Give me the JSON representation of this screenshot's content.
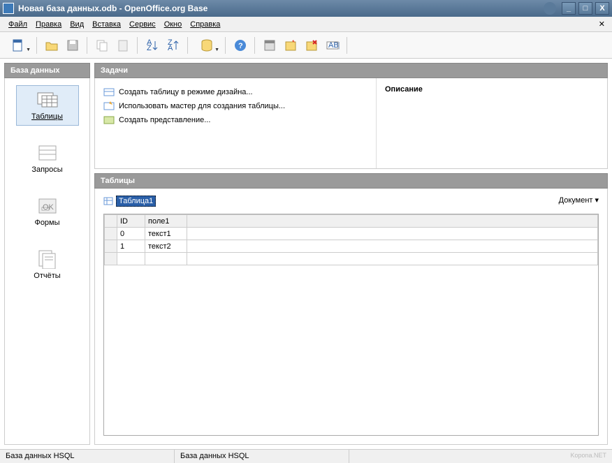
{
  "title": "Новая база данных.odb - OpenOffice.org Base",
  "window_controls": {
    "min": "_",
    "max": "□",
    "close": "X"
  },
  "menus": [
    "Файл",
    "Правка",
    "Вид",
    "Вставка",
    "Сервис",
    "Окно",
    "Справка"
  ],
  "sidebar": {
    "header": "База данных",
    "items": [
      {
        "label": "Таблицы",
        "active": true
      },
      {
        "label": "Запросы",
        "active": false
      },
      {
        "label": "Формы",
        "active": false
      },
      {
        "label": "Отчёты",
        "active": false
      }
    ]
  },
  "tasks": {
    "header": "Задачи",
    "links": [
      "Создать таблицу в режиме дизайна...",
      "Использовать мастер для создания таблицы...",
      "Создать представление..."
    ],
    "desc_label": "Описание"
  },
  "tables": {
    "header": "Таблицы",
    "item": "Таблица1",
    "view_menu": "Документ",
    "preview": {
      "columns": [
        "ID",
        "поле1"
      ],
      "rows": [
        {
          "id": "0",
          "f1": "текст1"
        },
        {
          "id": "1",
          "f1": "текст2"
        }
      ]
    }
  },
  "status": {
    "left": "База данных HSQL",
    "mid": "База данных HSQL"
  },
  "watermark": "Kopona.NET"
}
